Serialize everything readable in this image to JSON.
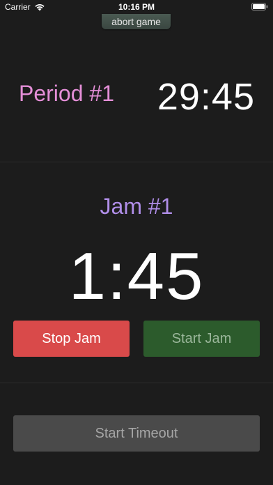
{
  "status_bar": {
    "carrier": "Carrier",
    "time": "10:16 PM",
    "wifi_icon": "wifi-icon",
    "battery_icon": "battery-icon"
  },
  "header": {
    "abort_label": "abort game"
  },
  "period": {
    "label": "Period #1",
    "clock": "29:45"
  },
  "jam": {
    "label": "Jam #1",
    "clock": "1:45"
  },
  "controls": {
    "stop_jam_label": "Stop Jam",
    "start_jam_label": "Start Jam",
    "start_timeout_label": "Start Timeout"
  },
  "colors": {
    "background": "#1c1c1c",
    "period_label": "#e58fd8",
    "jam_label": "#b08ee8",
    "stop_jam": "#d94a4a",
    "start_jam": "#2c5b2c",
    "start_timeout": "#4a4a4a"
  }
}
